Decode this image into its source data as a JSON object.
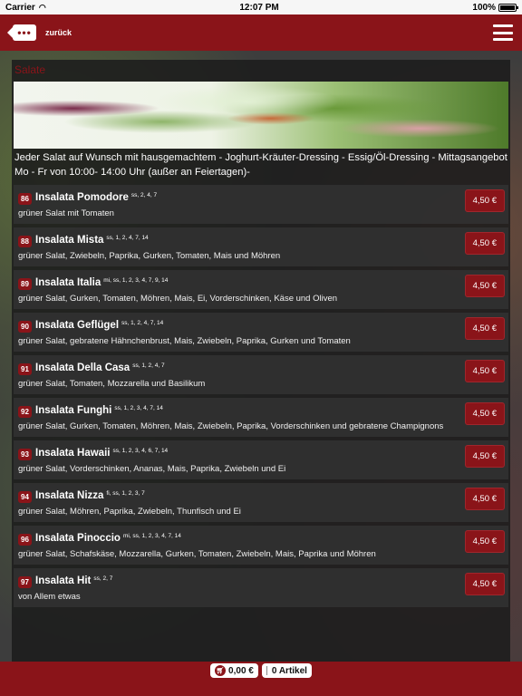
{
  "status": {
    "carrier": "Carrier",
    "time": "12:07 PM",
    "battery": "100%"
  },
  "nav": {
    "back_label": "zurück",
    "back_icon_text": "•••"
  },
  "section": {
    "title": "Salate",
    "intro": "Jeder Salat auf Wunsch mit hausgemachtem - Joghurt-Kräuter-Dressing - Essig/Öl-Dressing - Mittagsangebot Mo - Fr von 10:00- 14:00 Uhr (außer an Feiertagen)-"
  },
  "items": [
    {
      "num": "86",
      "name": "Insalata Pomodore",
      "allergens": "ss, 2, 4, 7",
      "desc": "grüner Salat mit Tomaten",
      "price": "4,50 €"
    },
    {
      "num": "88",
      "name": "Insalata Mista",
      "allergens": "ss, 1, 2, 4, 7, 14",
      "desc": "grüner Salat, Zwiebeln, Paprika, Gurken, Tomaten, Mais und Möhren",
      "price": "4,50 €"
    },
    {
      "num": "89",
      "name": "Insalata Italia",
      "allergens": "mi, ss, 1, 2, 3, 4, 7, 9, 14",
      "desc": "grüner Salat, Gurken, Tomaten, Möhren, Mais, Ei, Vorderschinken, Käse und Oliven",
      "price": "4,50 €"
    },
    {
      "num": "90",
      "name": "Insalata Geflügel",
      "allergens": "ss, 1, 2, 4, 7, 14",
      "desc": "grüner Salat, gebratene Hähnchenbrust, Mais, Zwiebeln, Paprika, Gurken und Tomaten",
      "price": "4,50 €"
    },
    {
      "num": "91",
      "name": "Insalata Della Casa",
      "allergens": "ss, 1, 2, 4, 7",
      "desc": "grüner Salat, Tomaten, Mozzarella und Basilikum",
      "price": "4,50 €"
    },
    {
      "num": "92",
      "name": "Insalata Funghi",
      "allergens": "ss, 1, 2, 3, 4, 7, 14",
      "desc": "grüner Salat, Gurken, Tomaten, Möhren, Mais, Zwiebeln, Paprika, Vorderschinken und gebratene Champignons",
      "price": "4,50 €"
    },
    {
      "num": "93",
      "name": "Insalata Hawaii",
      "allergens": "ss, 1, 2, 3, 4, 6, 7, 14",
      "desc": "grüner Salat, Vorderschinken, Ananas, Mais, Paprika, Zwiebeln und Ei",
      "price": "4,50 €"
    },
    {
      "num": "94",
      "name": "Insalata Nizza",
      "allergens": "fi, ss, 1, 2, 3, 7",
      "desc": "grüner Salat, Möhren, Paprika, Zwiebeln, Thunfisch und Ei",
      "price": "4,50 €"
    },
    {
      "num": "96",
      "name": "Insalata Pinoccio",
      "allergens": "mi, ss, 1, 2, 3, 4, 7, 14",
      "desc": "grüner Salat, Schafskäse, Mozzarella, Gurken, Tomaten, Zwiebeln, Mais, Paprika und Möhren",
      "price": "4,50 €"
    },
    {
      "num": "97",
      "name": "Insalata Hit",
      "allergens": "ss, 2, 7",
      "desc": "von Allem etwas",
      "price": "4,50 €"
    }
  ],
  "cart": {
    "total": "0,00 €",
    "count": "0 Artikel"
  }
}
